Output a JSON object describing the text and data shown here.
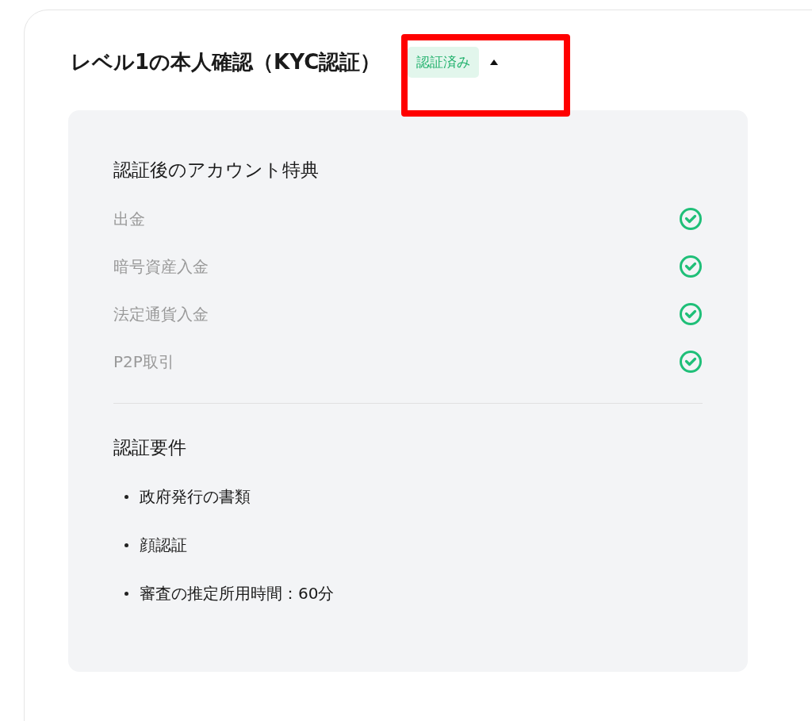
{
  "card": {
    "title": "レベル1の本人確認（KYC認証）",
    "status_badge": "認証済み",
    "expanded": true
  },
  "benefits": {
    "heading": "認証後のアカウント特典",
    "items": [
      {
        "label": "出金",
        "available": true
      },
      {
        "label": "暗号資産入金",
        "available": true
      },
      {
        "label": "法定通貨入金",
        "available": true
      },
      {
        "label": "P2P取引",
        "available": true
      }
    ]
  },
  "requirements": {
    "heading": "認証要件",
    "items": [
      "政府発行の書類",
      "顔認証",
      "審査の推定所用時間：60分"
    ]
  },
  "annotation": {
    "kind": "highlight-box"
  }
}
